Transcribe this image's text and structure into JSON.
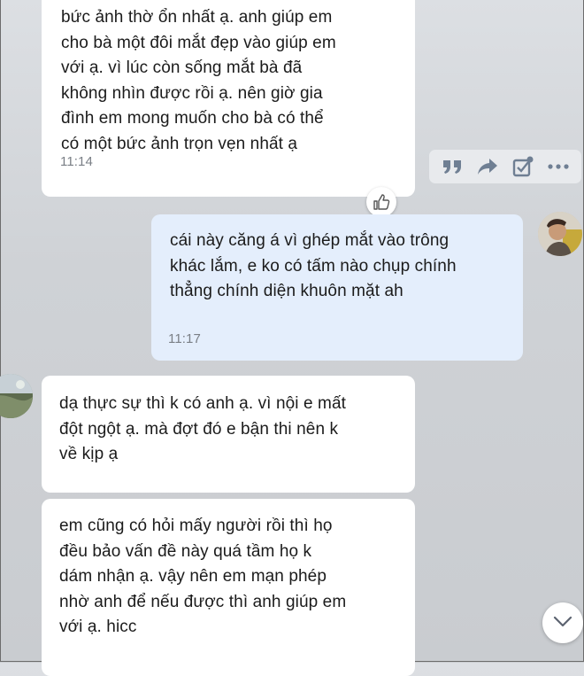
{
  "messages": [
    {
      "id": "msg1",
      "lines": [
        "bức ảnh thờ ổn nhất ạ. anh giúp em",
        "cho bà một đôi mắt đẹp vào giúp em",
        "với ạ. vì lúc còn sống mắt bà đã",
        "không nhìn được rồi ạ. nên giờ gia",
        "đình em mong muốn cho bà có thể",
        "có một bức ảnh trọn vẹn nhất ạ"
      ],
      "time": "11:14"
    },
    {
      "id": "msg2",
      "lines": [
        "cái này căng á vì ghép mắt vào trông",
        "khác lắm, e ko có tấm nào chụp chính",
        "thẳng chính diện khuôn mặt ah"
      ],
      "time": "11:17"
    },
    {
      "id": "msg3",
      "lines": [
        "dạ thực sự thì k có anh ạ. vì nội e mất",
        "đột ngột ạ. mà đợt đó e bận thi nên k",
        "về kịp ạ"
      ]
    },
    {
      "id": "msg4",
      "lines": [
        "em cũng có hỏi mấy người rồi thì họ",
        "đều bảo vấn đề này quá tầm họ k",
        "dám nhận ạ. vậy nên em mạn phép",
        "nhờ anh để nếu được thì anh giúp em",
        "với ạ. hicc"
      ]
    }
  ],
  "actions": [
    "quote-icon",
    "forward-icon",
    "task-icon",
    "more-icon"
  ],
  "icons": {
    "like": "thumbs-up-icon",
    "scroll": "chevron-down-icon"
  },
  "colors": {
    "incoming_bubble": "#ffffff",
    "outgoing_bubble": "#e4eefc",
    "timestamp": "#7a7f86",
    "action_icon": "#6f7f93"
  }
}
